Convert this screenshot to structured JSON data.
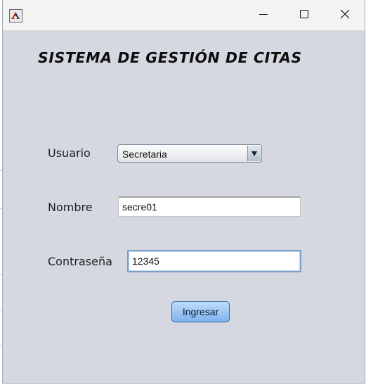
{
  "window": {
    "controls": {
      "minimize_icon": "minimize-icon",
      "maximize_icon": "maximize-icon",
      "close_icon": "close-icon"
    }
  },
  "form": {
    "title": "SISTEMA DE GESTIÓN DE CITAS",
    "usuario_label": "Usuario",
    "usuario_selected": "Secretaria",
    "nombre_label": "Nombre",
    "nombre_value": "secre01",
    "contrasena_label": "Contraseña",
    "contrasena_value": "12345",
    "submit_label": "Ingresar"
  },
  "colors": {
    "window_background": "#d5d8e0",
    "titlebar_background": "#f3f3f3",
    "button_accent": "#7fb2ee",
    "focus_border": "#7aa0cc"
  }
}
